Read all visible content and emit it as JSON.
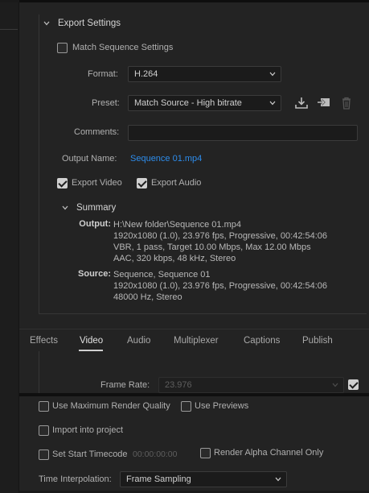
{
  "export_settings": {
    "title": "Export Settings",
    "match_sequence_label": "Match Sequence Settings",
    "format_label": "Format:",
    "format_value": "H.264",
    "preset_label": "Preset:",
    "preset_value": "Match Source - High bitrate",
    "comments_label": "Comments:",
    "comments_value": "",
    "output_name_label": "Output Name:",
    "output_name_value": "Sequence 01.mp4",
    "export_video_label": "Export Video",
    "export_audio_label": "Export Audio",
    "export_video_checked": true,
    "export_audio_checked": true,
    "match_sequence_checked": false,
    "icons": [
      "save-preset-icon",
      "import-preset-icon",
      "delete-preset-icon"
    ]
  },
  "summary": {
    "title": "Summary",
    "output_key": "Output:",
    "output_lines": [
      "H:\\New folder\\Sequence 01.mp4",
      "1920x1080 (1.0), 23.976 fps, Progressive, 00:42:54:06",
      "VBR, 1 pass, Target 10.00 Mbps, Max 12.00 Mbps",
      "AAC, 320 kbps, 48 kHz, Stereo"
    ],
    "source_key": "Source:",
    "source_lines": [
      "Sequence, Sequence 01",
      "1920x1080 (1.0), 23.976 fps, Progressive, 00:42:54:06",
      "48000 Hz, Stereo"
    ]
  },
  "tabs": [
    {
      "label": "Effects",
      "active": false
    },
    {
      "label": "Video",
      "active": true
    },
    {
      "label": "Audio",
      "active": false
    },
    {
      "label": "Multiplexer",
      "active": false
    },
    {
      "label": "Captions",
      "active": false
    },
    {
      "label": "Publish",
      "active": false
    }
  ],
  "video": {
    "frame_rate_label": "Frame Rate:",
    "frame_rate_value": "23.976",
    "frame_rate_checked": true
  },
  "options": {
    "max_render_quality_label": "Use Maximum Render Quality",
    "use_previews_label": "Use Previews",
    "import_project_label": "Import into project",
    "start_timecode_label": "Set Start Timecode",
    "start_timecode_value": "00:00:00:00",
    "alpha_only_label": "Render Alpha Channel Only",
    "time_interp_label": "Time Interpolation:",
    "time_interp_value": "Frame Sampling"
  },
  "colors": {
    "background": "#232323",
    "link": "#2d8ceb",
    "text": "#b8b8b8"
  }
}
